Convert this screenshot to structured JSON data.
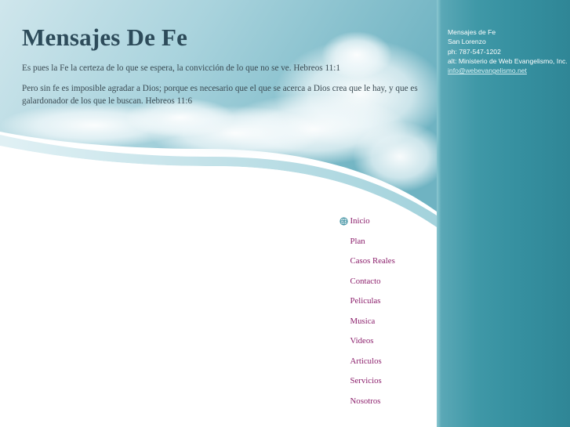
{
  "site": {
    "title": "Mensajes De Fe",
    "verse1": "Es pues la Fe la certeza de lo que se espera, la convicción de lo que no se ve.  Hebreos 11:1",
    "verse2": "Pero sin fe es imposible agradar a Dios; porque es necesario que el que se acerca a Dios crea que le hay, y que es galardonador de los que le buscan.   Hebreos 11:6"
  },
  "contact": {
    "name": "Mensajes de Fe",
    "city": "San Lorenzo",
    "phone": "ph: 787-547-1202",
    "alt": "alt: Ministerio de Web Evangelismo, Inc.",
    "email": "info@webevangelismo.net"
  },
  "nav": {
    "items": [
      {
        "label": "Inicio",
        "active": true
      },
      {
        "label": "Plan"
      },
      {
        "label": "Casos Reales"
      },
      {
        "label": "Contacto"
      },
      {
        "label": "Peliculas"
      },
      {
        "label": "Musica"
      },
      {
        "label": "Videos"
      },
      {
        "label": "Articulos"
      },
      {
        "label": "Servicios"
      },
      {
        "label": "Nosotros"
      }
    ]
  },
  "colors": {
    "title": "#2d4b5a",
    "nav_link": "#8b1e6b",
    "sidebar": "#3690a0",
    "sky": "#8fc7d3"
  }
}
